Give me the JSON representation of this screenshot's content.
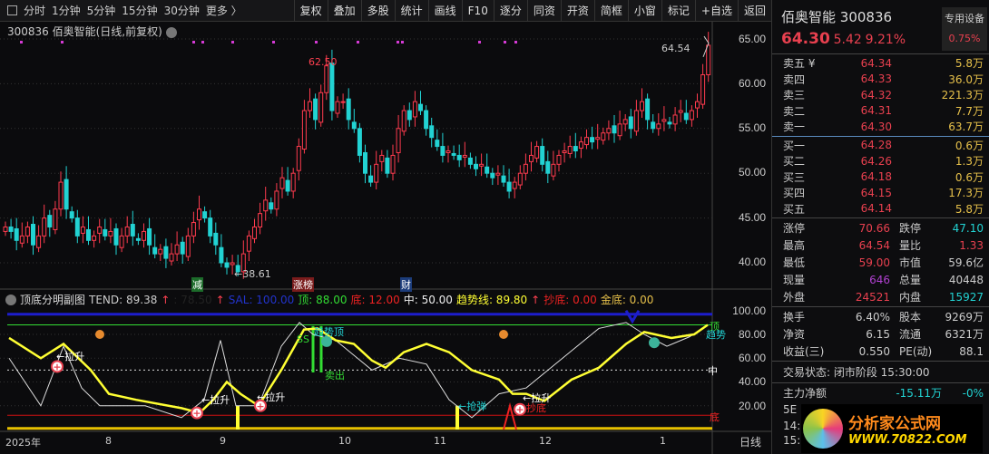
{
  "toolbar": {
    "periods": [
      "分时",
      "1分钟",
      "5分钟",
      "15分钟",
      "30分钟",
      "更多 〉"
    ],
    "buttons": [
      "复权",
      "叠加",
      "多股",
      "统计",
      "画线",
      "F10",
      "逐分",
      "同资",
      "开资",
      "简框",
      "小窗",
      "标记",
      "+自选",
      "返回"
    ]
  },
  "chart_header": {
    "title": "300836 佰奥智能(日线,前复权)"
  },
  "annotations": {
    "high_label": "62.50",
    "latest_high": "64.54",
    "low_label": "←38.61",
    "tag_jian": "减",
    "tag_zhangbang": "涨榜",
    "tag_cai": "财"
  },
  "indicator": {
    "name": "顶底分明副图",
    "tend": "TEND: 89.38",
    "blank": ": 78.50",
    "sal": "SAL: 100.00",
    "top": "顶: 88.00",
    "bottom": "底: 12.00",
    "mid": "中: 50.00",
    "trend": "趋势线: 89.80",
    "chaodi": "抄底: 0.00",
    "jindi": "金底: 0.00",
    "labels": {
      "lasheng": "←拉升",
      "qiangtan": "←抢弹",
      "qushi_ding": "趋势顶",
      "maichu": "卖出",
      "chaodi": "抄底",
      "ding": "顶",
      "di": "底",
      "zhong": "中",
      "qushi_short": "趋势",
      "ss": "SS"
    }
  },
  "axis": {
    "price_ticks": [
      "65.00",
      "60.00",
      "55.00",
      "50.00",
      "45.00",
      "40.00"
    ],
    "ind_ticks": [
      "100.00",
      "80.00",
      "60.00",
      "40.00",
      "20.00"
    ],
    "months": [
      "2025年",
      "8",
      "9",
      "10",
      "11",
      "12",
      "1"
    ],
    "period": "日线"
  },
  "chart_data": {
    "type": "candlestick",
    "price_range": [
      38,
      66
    ],
    "closes": [
      44,
      43.5,
      42.5,
      43,
      44,
      42,
      43,
      45,
      44,
      46,
      49,
      46,
      45,
      43,
      44,
      42.5,
      43,
      44,
      43,
      43.5,
      42,
      43,
      44,
      43,
      42.5,
      43.5,
      42,
      41,
      41.5,
      40.5,
      41,
      42,
      41,
      43,
      44.5,
      46,
      45,
      43,
      42,
      40,
      39.5,
      40,
      39,
      41,
      43,
      44,
      45.5,
      47,
      46,
      48,
      49.5,
      48,
      50,
      53,
      57,
      58,
      56,
      59,
      62,
      57,
      58,
      58,
      56,
      55,
      52,
      50,
      49,
      51,
      52,
      50,
      52,
      55,
      57,
      56,
      58,
      57,
      55,
      54,
      53,
      52,
      52.5,
      52,
      51.5,
      52,
      51,
      50.5,
      51,
      50,
      49.5,
      50,
      49,
      48,
      49,
      50,
      51,
      52,
      53,
      51,
      50,
      51,
      52,
      52.5,
      53,
      52.5,
      53.5,
      54,
      53.5,
      54,
      54.5,
      55,
      54.5,
      55.5,
      56,
      55,
      57,
      58,
      56,
      55,
      55.5,
      56,
      55.5,
      56.5,
      57,
      56,
      57,
      58,
      61,
      64.3
    ],
    "indicator_series": [
      {
        "name": "趋势线",
        "color": "#ffff33",
        "points": [
          [
            10,
            77
          ],
          [
            45,
            60
          ],
          [
            70,
            72
          ],
          [
            100,
            50
          ],
          [
            120,
            30
          ],
          [
            150,
            25
          ],
          [
            200,
            18
          ],
          [
            220,
            14
          ],
          [
            235,
            25
          ],
          [
            250,
            40
          ],
          [
            265,
            30
          ],
          [
            285,
            20
          ],
          [
            310,
            50
          ],
          [
            335,
            84
          ],
          [
            350,
            85
          ],
          [
            370,
            75
          ],
          [
            390,
            72
          ],
          [
            410,
            58
          ],
          [
            425,
            52
          ],
          [
            445,
            65
          ],
          [
            470,
            72
          ],
          [
            495,
            65
          ],
          [
            520,
            50
          ],
          [
            550,
            42
          ],
          [
            565,
            30
          ],
          [
            580,
            30
          ],
          [
            600,
            24
          ],
          [
            630,
            42
          ],
          [
            660,
            52
          ],
          [
            690,
            72
          ],
          [
            710,
            82
          ],
          [
            740,
            77
          ],
          [
            765,
            80
          ],
          [
            780,
            88
          ]
        ]
      },
      {
        "name": "TEND",
        "color": "#dddddd",
        "points": [
          [
            10,
            60
          ],
          [
            45,
            20
          ],
          [
            70,
            70
          ],
          [
            90,
            35
          ],
          [
            110,
            20
          ],
          [
            160,
            20
          ],
          [
            200,
            10
          ],
          [
            225,
            25
          ],
          [
            243,
            75
          ],
          [
            260,
            20
          ],
          [
            285,
            20
          ],
          [
            310,
            70
          ],
          [
            330,
            90
          ],
          [
            345,
            80
          ],
          [
            370,
            75
          ],
          [
            410,
            50
          ],
          [
            440,
            60
          ],
          [
            470,
            55
          ],
          [
            495,
            25
          ],
          [
            520,
            10
          ],
          [
            550,
            30
          ],
          [
            580,
            35
          ],
          [
            620,
            60
          ],
          [
            660,
            85
          ],
          [
            690,
            90
          ],
          [
            710,
            80
          ],
          [
            735,
            70
          ],
          [
            760,
            78
          ],
          [
            780,
            88
          ]
        ]
      }
    ]
  },
  "quote": {
    "name": "佰奥智能",
    "code": "300836",
    "price": "64.30",
    "change": "5.42",
    "pct": "9.21%",
    "tag": "专用设备",
    "tag_pct": "0.75%",
    "asks": [
      {
        "k": "卖五 ¥",
        "p": "64.34",
        "v": "5.8万"
      },
      {
        "k": "卖四",
        "p": "64.33",
        "v": "36.0万"
      },
      {
        "k": "卖三",
        "p": "64.32",
        "v": "221.3万"
      },
      {
        "k": "卖二",
        "p": "64.31",
        "v": "7.7万"
      },
      {
        "k": "卖一",
        "p": "64.30",
        "v": "63.7万"
      }
    ],
    "bids": [
      {
        "k": "买一",
        "p": "64.28",
        "v": "0.6万"
      },
      {
        "k": "买二",
        "p": "64.26",
        "v": "1.3万"
      },
      {
        "k": "买三",
        "p": "64.18",
        "v": "0.6万"
      },
      {
        "k": "买四",
        "p": "64.15",
        "v": "17.3万"
      },
      {
        "k": "买五",
        "p": "64.14",
        "v": "5.8万"
      }
    ],
    "stats1": [
      [
        "涨停",
        "70.66",
        "跌停",
        "47.10"
      ],
      [
        "最高",
        "64.54",
        "量比",
        "1.33"
      ],
      [
        "最低",
        "59.00",
        "市值",
        "59.6亿"
      ],
      [
        "现量",
        "646",
        "总量",
        "40448"
      ],
      [
        "外盘",
        "24521",
        "内盘",
        "15927"
      ]
    ],
    "stats2": [
      [
        "换手",
        "6.40%",
        "股本",
        "9269万"
      ],
      [
        "净资",
        "6.15",
        "流通",
        "6321万"
      ],
      [
        "收益(三)",
        "0.550",
        "PE(动)",
        "88.1"
      ]
    ],
    "status": "交易状态: 闭市阶段 15:30:00",
    "main_flow": "主力净额",
    "flow_val": "-15.11万",
    "flow_pct": "-0%",
    "row5": "5E",
    "t1": "14:",
    "t2": "15:"
  },
  "logo": {
    "text": "分析家公式网",
    "url": "WWW.70822.COM"
  },
  "colors": {
    "up": "#ff3b4e",
    "down": "#22d3d3",
    "bg": "#0b0b0d"
  }
}
